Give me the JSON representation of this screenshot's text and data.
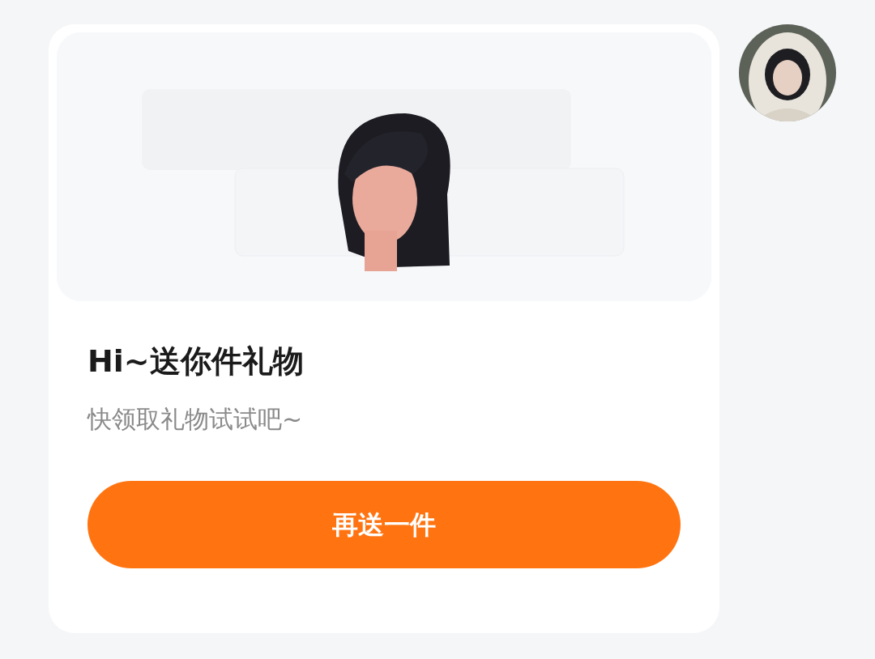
{
  "message": {
    "title": "Hi~送你件礼物",
    "subtitle": "快领取礼物试试吧~",
    "button": "再送一件"
  }
}
